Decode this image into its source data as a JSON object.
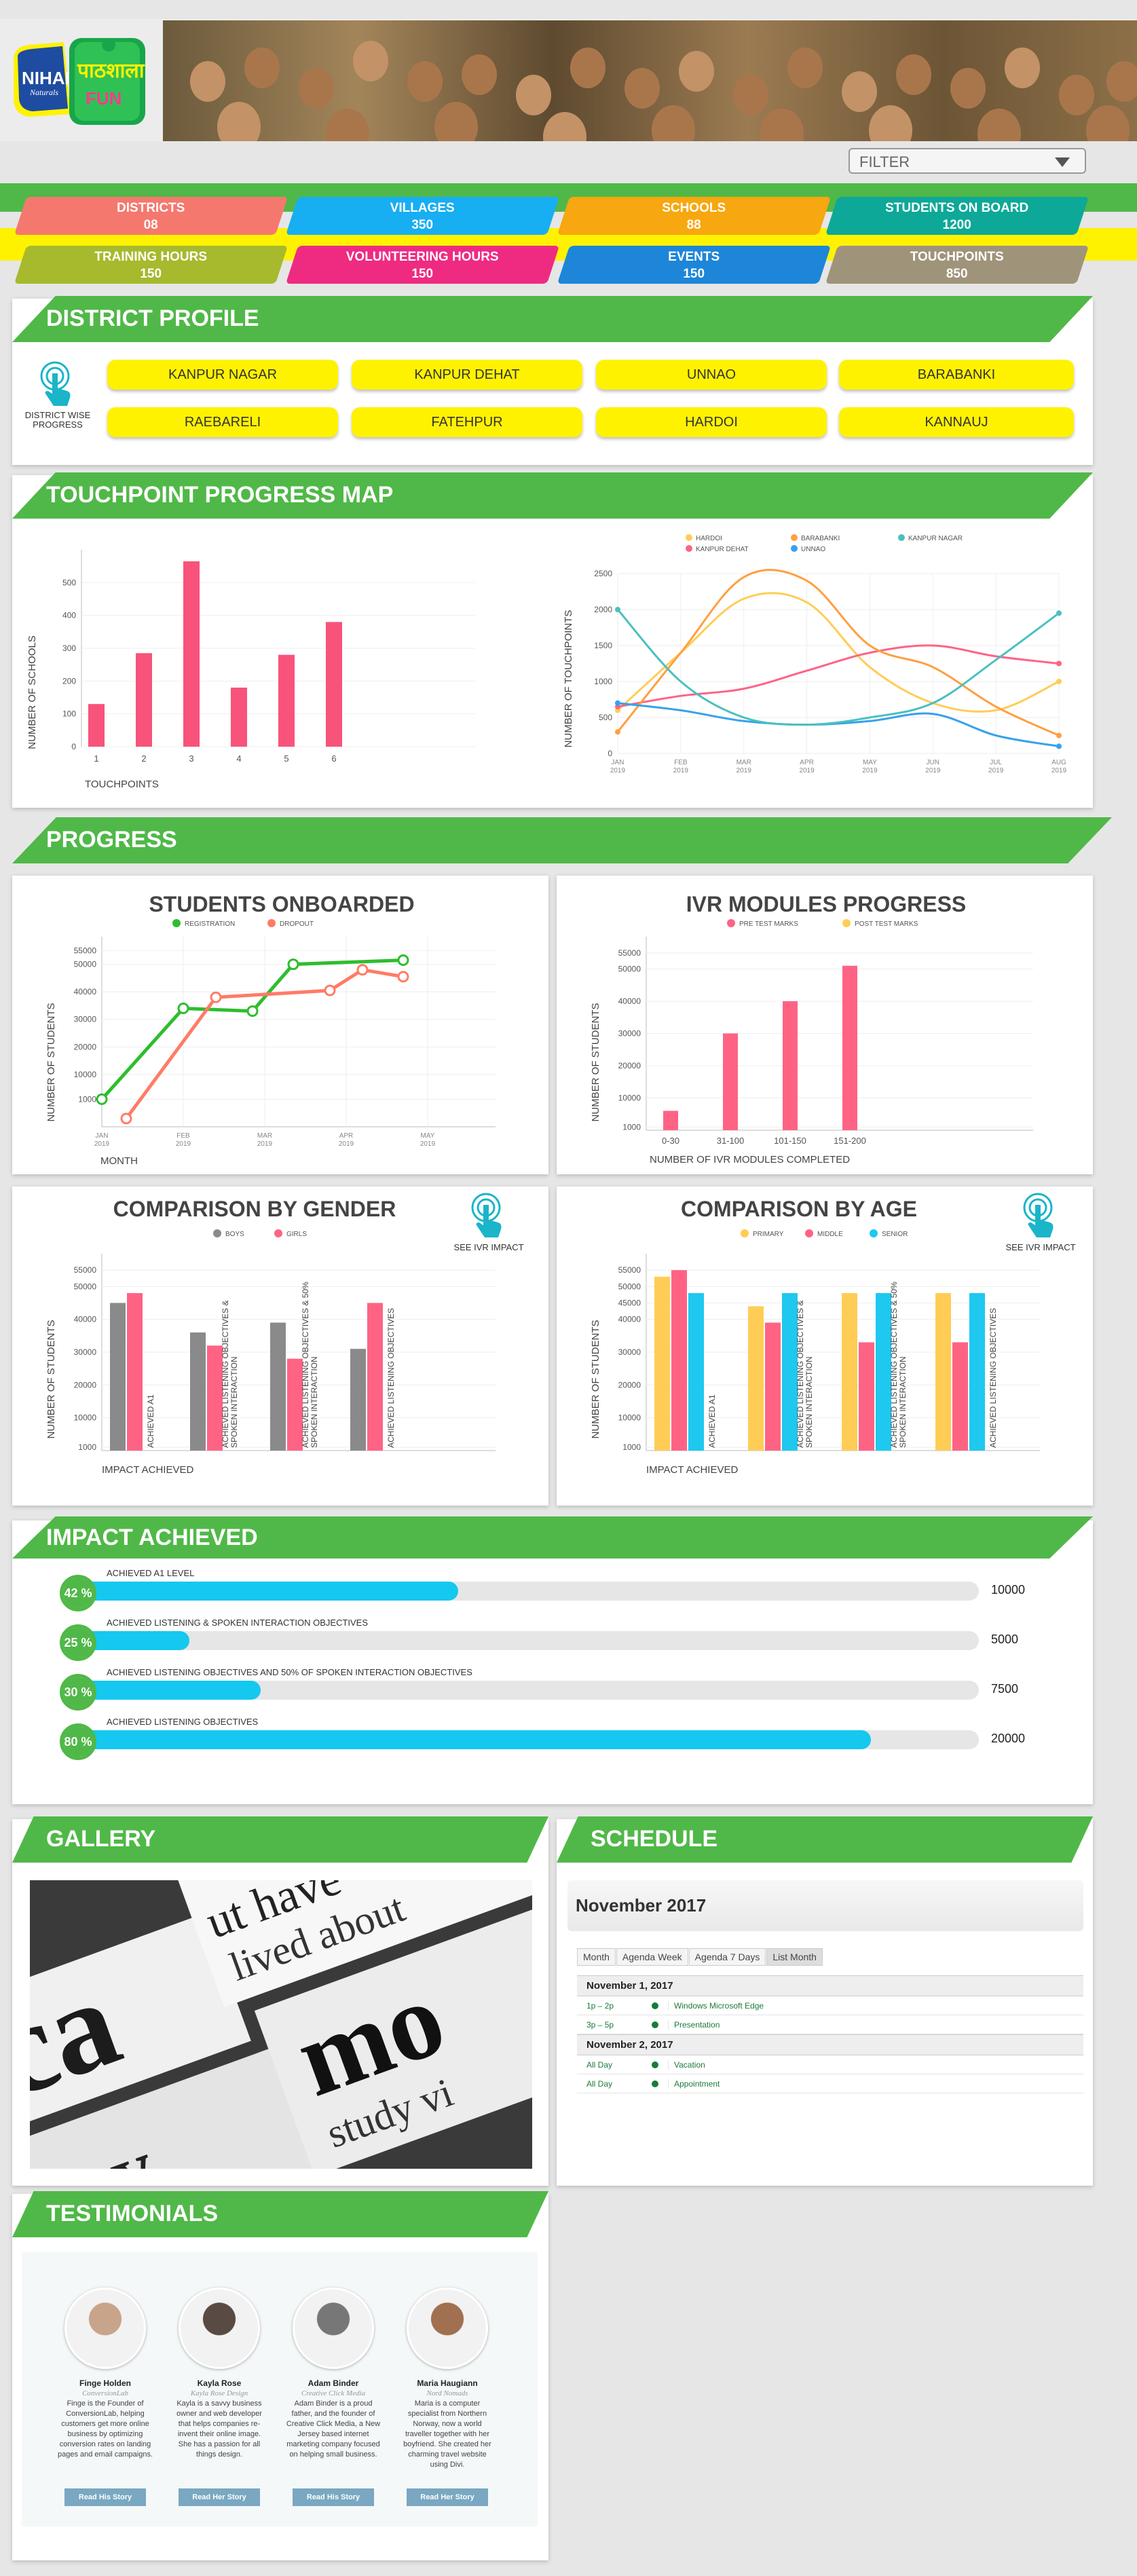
{
  "header": {
    "logo_brand": "NIHAR",
    "logo_sub": "Naturals",
    "logo_hindi": "पाठशाला",
    "logo_fun": "FUN"
  },
  "filter": {
    "label": "FILTER"
  },
  "stats": [
    {
      "label": "DISTRICTS",
      "value": "08",
      "color": "#f5786e"
    },
    {
      "label": "VILLAGES",
      "value": "350",
      "color": "#18aef2"
    },
    {
      "label": "SCHOOLS",
      "value": "88",
      "color": "#f7a70f"
    },
    {
      "label": "STUDENTS ON BOARD",
      "value": "1200",
      "color": "#0ea898"
    },
    {
      "label": "TRAINING HOURS",
      "value": "150",
      "color": "#a7b92d"
    },
    {
      "label": "VOLUNTEERING HOURS",
      "value": "150",
      "color": "#ee2b81"
    },
    {
      "label": "EVENTS",
      "value": "150",
      "color": "#1d86d9"
    },
    {
      "label": "TOUCHPOINTS",
      "value": "850",
      "color": "#9f9479"
    }
  ],
  "district_profile": {
    "title": "DISTRICT PROFILE",
    "icon_label": "DISTRICT WISE PROGRESS",
    "districts": [
      "KANPUR NAGAR",
      "KANPUR DEHAT",
      "UNNAO",
      "BARABANKI",
      "RAEBARELI",
      "FATEHPUR",
      "HARDOI",
      "KANNAUJ"
    ]
  },
  "touchpoint": {
    "title": "TOUCHPOINT PROGRESS MAP"
  },
  "progress": {
    "title": "PROGRESS"
  },
  "impact": {
    "title": "IMPACT ACHIEVED",
    "items": [
      {
        "pct": "42 %",
        "label": "ACHIEVED A1 LEVEL",
        "fill": 0.42,
        "count": "10000"
      },
      {
        "pct": "25 %",
        "label": "ACHIEVED LISTENING & SPOKEN INTERACTION OBJECTIVES",
        "fill": 0.12,
        "count": "5000"
      },
      {
        "pct": "30 %",
        "label": "ACHIEVED LISTENING OBJECTIVES AND 50% OF SPOKEN INTERACTION OBJECTIVES",
        "fill": 0.2,
        "count": "7500"
      },
      {
        "pct": "80 %",
        "label": "ACHIEVED LISTENING OBJECTIVES",
        "fill": 0.88,
        "count": "20000"
      }
    ]
  },
  "gallery": {
    "title": "GALLERY"
  },
  "schedule": {
    "title": "SCHEDULE",
    "month": "November 2017",
    "tabs": [
      "Month",
      "Agenda Week",
      "Agenda 7 Days",
      "List Month"
    ],
    "days": [
      {
        "date": "November 1, 2017",
        "events": [
          {
            "time": "1p – 2p",
            "name": "Windows Microsoft Edge"
          },
          {
            "time": "3p – 5p",
            "name": "Presentation"
          }
        ]
      },
      {
        "date": "November 2, 2017",
        "events": [
          {
            "time": "All Day",
            "name": "Vacation"
          },
          {
            "time": "All Day",
            "name": "Appointment"
          }
        ]
      }
    ]
  },
  "testimonials": {
    "title": "TESTIMONIALS",
    "people": [
      {
        "name": "Finge Holden",
        "company": "ConversionLab",
        "bio": "Finge is the Founder of ConversionLab, helping customers get more online business by optimizing conversion rates on landing pages and email campaigns.",
        "button": "Read His Story",
        "color": "#c8a48a"
      },
      {
        "name": "Kayla Rose",
        "company": "Kayla Rose Design",
        "bio": "Kayla is a savvy business owner and web developer that helps companies re-invent their online image. She has a passion for all things design.",
        "button": "Read Her Story",
        "color": "#5a4a44"
      },
      {
        "name": "Adam Binder",
        "company": "Creative Click Media",
        "bio": "Adam Binder is a proud father, and the founder of Creative Click Media, a New Jersey based internet marketing company focused on helping small business.",
        "button": "Read His Story",
        "color": "#777"
      },
      {
        "name": "Maria Haugiann",
        "company": "Nord Nomads",
        "bio": "Maria is a computer specialist from Northern Norway, now a world traveller together with her boyfriend. She created her charming travel website using Divi.",
        "button": "Read Her Story",
        "color": "#a07050"
      }
    ]
  },
  "chart_data": [
    {
      "type": "bar",
      "title": "",
      "xlabel": "TOUCHPOINTS",
      "ylabel": "NUMBER OF SCHOOLS",
      "categories": [
        "1",
        "2",
        "3",
        "4",
        "5",
        "6"
      ],
      "values": [
        130,
        285,
        565,
        180,
        280,
        380
      ],
      "ylim": [
        0,
        600
      ],
      "yticks": [
        0,
        100,
        200,
        300,
        400,
        500
      ],
      "color": "#f8537a"
    },
    {
      "type": "line",
      "title": "",
      "xlabel": "MONTH",
      "ylabel": "NUMBER OF TOUCHPOINTS",
      "categories": [
        "JAN 2019",
        "FEB 2019",
        "MAR 2019",
        "APR 2019",
        "MAY 2019",
        "JUN 2019",
        "JUL 2019",
        "AUG 2019"
      ],
      "ylim": [
        0,
        2500
      ],
      "yticks": [
        0,
        500,
        1000,
        1500,
        2000,
        2500
      ],
      "series": [
        {
          "name": "HARDOI",
          "color": "#ffcd56",
          "values": [
            600,
            1400,
            2150,
            2100,
            1200,
            700,
            600,
            1000
          ]
        },
        {
          "name": "KANPUR DEHAT",
          "color": "#ff6384",
          "values": [
            650,
            800,
            900,
            1150,
            1400,
            1500,
            1350,
            1250
          ]
        },
        {
          "name": "BARABANKI",
          "color": "#ff9f40",
          "values": [
            300,
            1400,
            2450,
            2400,
            1500,
            1200,
            650,
            250
          ]
        },
        {
          "name": "UNNAO",
          "color": "#36a2eb",
          "values": [
            700,
            600,
            450,
            400,
            450,
            550,
            250,
            100
          ]
        },
        {
          "name": "KANPUR NAGAR",
          "color": "#4bc0c0",
          "values": [
            2000,
            1000,
            500,
            400,
            500,
            700,
            1300,
            1950
          ]
        }
      ]
    },
    {
      "type": "line",
      "title": "STUDENTS ONBOARDED",
      "xlabel": "MONTH",
      "ylabel": "NUMBER OF STUDENTS",
      "categories": [
        "JAN 2019",
        "FEB 2019",
        "MAR 2019",
        "APR 2019",
        "MAY 2019"
      ],
      "ylim": [
        0,
        60000
      ],
      "yticks": [
        1000,
        10000,
        20000,
        30000,
        40000,
        50000,
        55000
      ],
      "series": [
        {
          "name": "REGISTRATION",
          "color": "#2ebd2e",
          "x": [
            0,
            1,
            1.85,
            2.35,
            3.7
          ],
          "values": [
            1000,
            34000,
            33000,
            50000,
            51500
          ]
        },
        {
          "name": "DROPOUT",
          "color": "#ff7b67",
          "x": [
            0.3,
            1.4,
            2.8,
            3.2,
            3.7
          ],
          "values": [
            -6000,
            38000,
            40500,
            48000,
            45500
          ]
        }
      ]
    },
    {
      "type": "bar",
      "title": "IVR MODULES PROGRESS",
      "xlabel": "NUMBER OF IVR MODULES COMPLETED",
      "ylabel": "NUMBER OF STUDENTS",
      "categories": [
        "0-30",
        "31-100",
        "101-150",
        "151-200"
      ],
      "ylim": [
        0,
        60000
      ],
      "yticks": [
        1000,
        10000,
        20000,
        30000,
        40000,
        50000,
        55000
      ],
      "series": [
        {
          "name": "PRE TEST MARKS",
          "color": "#ff6384",
          "values": [
            6000,
            30000,
            40000,
            51000
          ]
        },
        {
          "name": "POST TEST MARKS",
          "color": "#ffcd56",
          "values": [
            0,
            0,
            0,
            0
          ]
        }
      ]
    },
    {
      "type": "bar",
      "title": "COMPARISON BY GENDER",
      "xlabel": "IMPACT ACHIEVED",
      "ylabel": "NUMBER OF STUDENTS",
      "categories": [
        "ACHIEVED A1",
        "ACHIEVED LISTENING OBJECTIVES & SPOKEN INTERACTION",
        "ACHIEVED LISTENING OBJECTIVES & 50% SPOKEN INTERACTION",
        "ACHIEVED LISTENING OBJECTIVES"
      ],
      "ylim": [
        0,
        60000
      ],
      "yticks": [
        1000,
        10000,
        20000,
        30000,
        40000,
        50000,
        55000
      ],
      "series": [
        {
          "name": "BOYS",
          "color": "#8a8a8a",
          "values": [
            45000,
            36000,
            39000,
            31000
          ]
        },
        {
          "name": "GIRLS",
          "color": "#ff6384",
          "values": [
            48000,
            32000,
            28000,
            45000
          ]
        }
      ]
    },
    {
      "type": "bar",
      "title": "COMPARISON BY AGE",
      "xlabel": "IMPACT ACHIEVED",
      "ylabel": "NUMBER OF STUDENTS",
      "categories": [
        "ACHIEVED A1",
        "ACHIEVED LISTENING OBJECTIVES & SPOKEN INTERACTION",
        "ACHIEVED LISTENING OBJECTIVES & 50% SPOKEN INTERACTION",
        "ACHIEVED LISTENING OBJECTIVES"
      ],
      "ylim": [
        0,
        60000
      ],
      "yticks": [
        1000,
        10000,
        20000,
        30000,
        40000,
        45000,
        50000,
        55000
      ],
      "series": [
        {
          "name": "PRIMARY",
          "color": "#ffcd56",
          "values": [
            53000,
            44000,
            48000,
            48000
          ]
        },
        {
          "name": "MIDDLE",
          "color": "#ff6384",
          "values": [
            55000,
            39000,
            33000,
            33000
          ]
        },
        {
          "name": "SENIOR",
          "color": "#1ec8ef",
          "values": [
            48000,
            48000,
            48000,
            48000
          ]
        }
      ]
    }
  ],
  "gender_icon_label": "SEE IVR IMPACT",
  "age_icon_label": "SEE IVR IMPACT"
}
